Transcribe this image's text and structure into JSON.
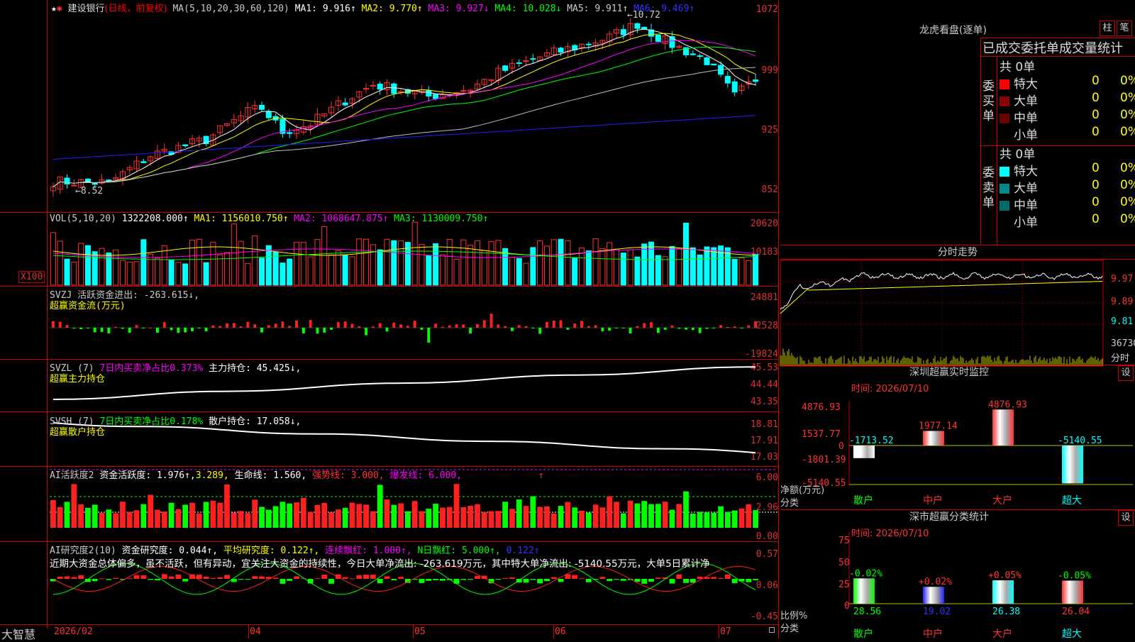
{
  "stock": {
    "name": "建设银行",
    "mode": "(日线，前复权)"
  },
  "icons": {
    "star": "★",
    "gear": "✱"
  },
  "ma_line": {
    "label": "MA(5,10,20,30,60,120)",
    "items": [
      {
        "text": "MA1: 9.916↑",
        "color": "#ffffff"
      },
      {
        "text": "MA2: 9.770↑",
        "color": "#ffff00"
      },
      {
        "text": "MA3: 9.927↓",
        "color": "#ff00ff"
      },
      {
        "text": "MA4: 10.028↓",
        "color": "#00ff00"
      },
      {
        "text": "MA5: 9.911↑",
        "color": "#c0c0c0"
      },
      {
        "text": "MA6: 9.469↑",
        "color": "#0000ff"
      }
    ],
    "max_label": "←10.72",
    "min_label": "←8.52"
  },
  "price_axis": [
    "1072",
    "999",
    "925",
    "852"
  ],
  "price_range": [
    8.4,
    10.76
  ],
  "vol": {
    "title": "VOL(5,10,20)",
    "value": "1322208.000↑",
    "ma1": "MA1: 1156010.750↑",
    "ma2": "MA2: 1068647.875↑",
    "ma3": "MA3: 1130009.750↑",
    "axis": [
      "20620",
      "10183"
    ],
    "unit": "X100"
  },
  "svzj": {
    "title": "SVZJ  活跃资金进出: -263.615↓,",
    "subtitle": "超赢资金流(万元)",
    "axis": [
      "24881",
      "2528",
      "-19824"
    ]
  },
  "svzl": {
    "title": "SVZL (7)",
    "ratio": "7日内买卖净占比0.373%",
    "hold": "主力持仓: 45.425↓,",
    "subtitle": "超赢主力持仓",
    "axis": [
      "45.53",
      "44.44",
      "43.35"
    ]
  },
  "svsh": {
    "title": "SVSH (7)",
    "ratio": "7日内买卖净占比0.178%",
    "hold": "散户持仓: 17.058↓,",
    "subtitle": "超赢散户持仓",
    "axis": [
      "18.81",
      "17.91",
      "17.03"
    ]
  },
  "ai_active": {
    "title": "AI活跃度2",
    "a": "资金活跃度: 1.976↑,",
    "b": "3.289,",
    "c": "生命线: 1.560,",
    "d": "强势线: 3.000,",
    "e": "爆发线: 6.000,",
    "f": "↑",
    "axis": [
      "6.00",
      "2.96",
      "0.00"
    ]
  },
  "ai_research": {
    "title": "AI研究度2(10)",
    "a": "资金研究度: 0.044↑,",
    "b": "平均研究度: 0.122↑,",
    "c": "连续飘红: 1.000↑,",
    "d": "N日飘红: 5.000↑,",
    "e": "0.122↑",
    "comment": "近期大资金总体偏多，虽不活跃，但有异动，宜关注大资金的持续性，今日大单净流出: -263.619万元，其中特大单净流出: -5140.55万元，大单5日累计净",
    "axis": [
      "0.57",
      "0.06",
      "-0.45"
    ]
  },
  "dates": {
    "brand": "大智慧",
    "labels": [
      "2026/02",
      "04",
      "05",
      "06",
      "07"
    ]
  },
  "lhb": {
    "title": "龙虎看盘(逐单)",
    "btn_a": "柱",
    "btn_b": "笔",
    "header": "已成交委托单成交量统计",
    "buy_label": "委买单",
    "sell_label": "委卖单",
    "buy_total": "共 0单",
    "sell_total": "共 0单",
    "buy_rows": [
      {
        "name": "特大",
        "count": "0",
        "pct": "0%",
        "color": "#ff0000"
      },
      {
        "name": "大单",
        "count": "0",
        "pct": "0%",
        "color": "#8b0000"
      },
      {
        "name": "中单",
        "count": "0",
        "pct": "0%",
        "color": "#6b0000"
      },
      {
        "name": "小单",
        "count": "0",
        "pct": "0%",
        "color": ""
      }
    ],
    "sell_rows": [
      {
        "name": "特大",
        "count": "0",
        "pct": "0%",
        "color": "#00ffff"
      },
      {
        "name": "大单",
        "count": "0",
        "pct": "0%",
        "color": "#008b8b"
      },
      {
        "name": "中单",
        "count": "0",
        "pct": "0%",
        "color": "#006b6b"
      },
      {
        "name": "小单",
        "count": "0",
        "pct": "0%",
        "color": ""
      }
    ]
  },
  "intraday": {
    "title": "分时走势",
    "axis": [
      "9.97",
      "9.89",
      "9.81"
    ],
    "vol_label": "36730",
    "vol_unit": "分时"
  },
  "sz_monitor": {
    "title": "深圳超赢实时监控",
    "btn": "设",
    "time": "时间: 2026/07/10",
    "axis": [
      "4876.93",
      "1537.77",
      "0",
      "-1801.39",
      "-5140.55"
    ],
    "axis_title": "净额(万元)",
    "cat_title": "分类",
    "categories": [
      "散户",
      "中户",
      "大户",
      "超大"
    ],
    "values": [
      -1713.52,
      1977.14,
      4876.93,
      -5140.55
    ],
    "value_labels": [
      "-1713.52",
      "1977.14",
      "4876.93",
      "-5140.55"
    ]
  },
  "sz_class": {
    "title": "深市超赢分类统计",
    "btn": "设",
    "time": "时间: 2026/07/10",
    "axis": [
      "75",
      "50",
      "25",
      "0"
    ],
    "axis_title": "比例%",
    "cat_title": "分类",
    "categories": [
      "散户",
      "中户",
      "大户",
      "超大"
    ],
    "values": [
      28.56,
      19.02,
      26.38,
      26.04
    ],
    "value_labels": [
      "28.56",
      "19.02",
      "26.38",
      "26.04"
    ],
    "changes": [
      "-0.02%",
      "+0.02%",
      "+0.05%",
      "-0.05%"
    ]
  },
  "chart_data": [
    {
      "type": "bar",
      "title": "深圳超赢实时监控",
      "categories": [
        "散户",
        "中户",
        "大户",
        "超大"
      ],
      "values": [
        -1713.52,
        1977.14,
        4876.93,
        -5140.55
      ],
      "ylabel": "净额(万元)",
      "ylim": [
        -5140.55,
        4876.93
      ]
    },
    {
      "type": "bar",
      "title": "深市超赢分类统计",
      "categories": [
        "散户",
        "中户",
        "大户",
        "超大"
      ],
      "values": [
        28.56,
        19.02,
        26.38,
        26.04
      ],
      "ylabel": "比例%",
      "ylim": [
        0,
        75
      ]
    }
  ]
}
